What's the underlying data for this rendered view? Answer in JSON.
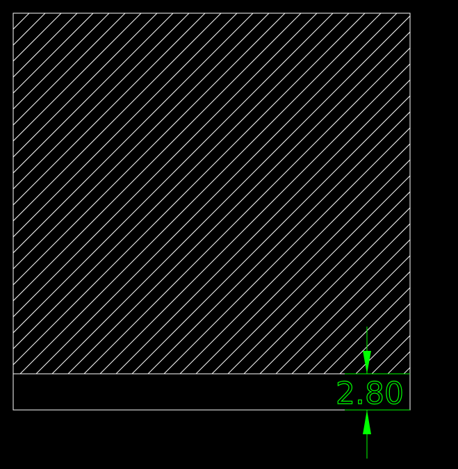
{
  "drawing": {
    "background_color": "#000000",
    "outline_color": "#ffffff",
    "hatch_color": "#ffffff",
    "dimension_color": "#00ff00",
    "hatch_pattern": "diagonal-lines",
    "dimension": {
      "value_label": "2.80",
      "orientation": "vertical"
    }
  }
}
